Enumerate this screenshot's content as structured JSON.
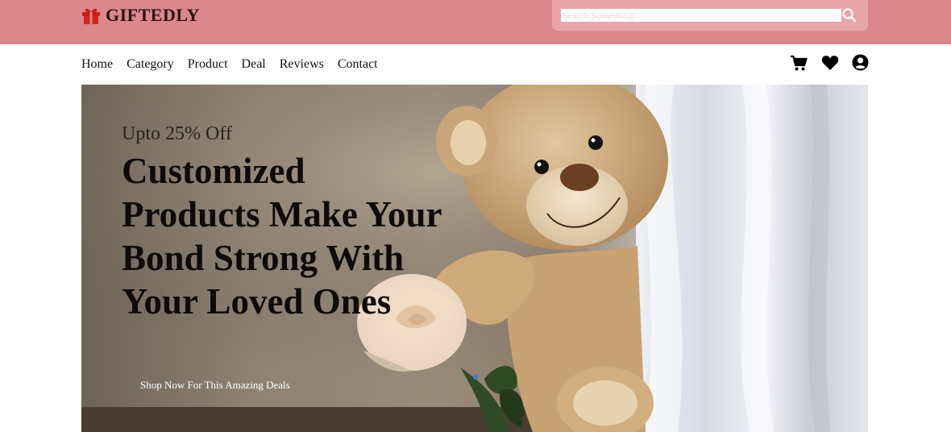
{
  "brand": {
    "name": "GIFTEDLY",
    "logo_icon": "gift-icon",
    "colors": {
      "topbar": "#db878d",
      "search_panel": "#e8a6ab",
      "accent_dot": "#3b7bd9"
    }
  },
  "search": {
    "placeholder": "Search Something...",
    "value": "",
    "button_icon": "search-icon"
  },
  "nav": {
    "items": [
      {
        "label": "Home"
      },
      {
        "label": "Category"
      },
      {
        "label": "Product"
      },
      {
        "label": "Deal"
      },
      {
        "label": "Reviews"
      },
      {
        "label": "Contact"
      }
    ],
    "icons": [
      "cart-icon",
      "heart-icon",
      "user-icon"
    ]
  },
  "hero": {
    "kicker": "Upto 25% Off",
    "title": "Customized Products Make Your Bond Strong With Your Loved Ones",
    "cta": "Shop Now For This Amazing Deals",
    "image": "teddy-bear-with-rose-photo"
  }
}
